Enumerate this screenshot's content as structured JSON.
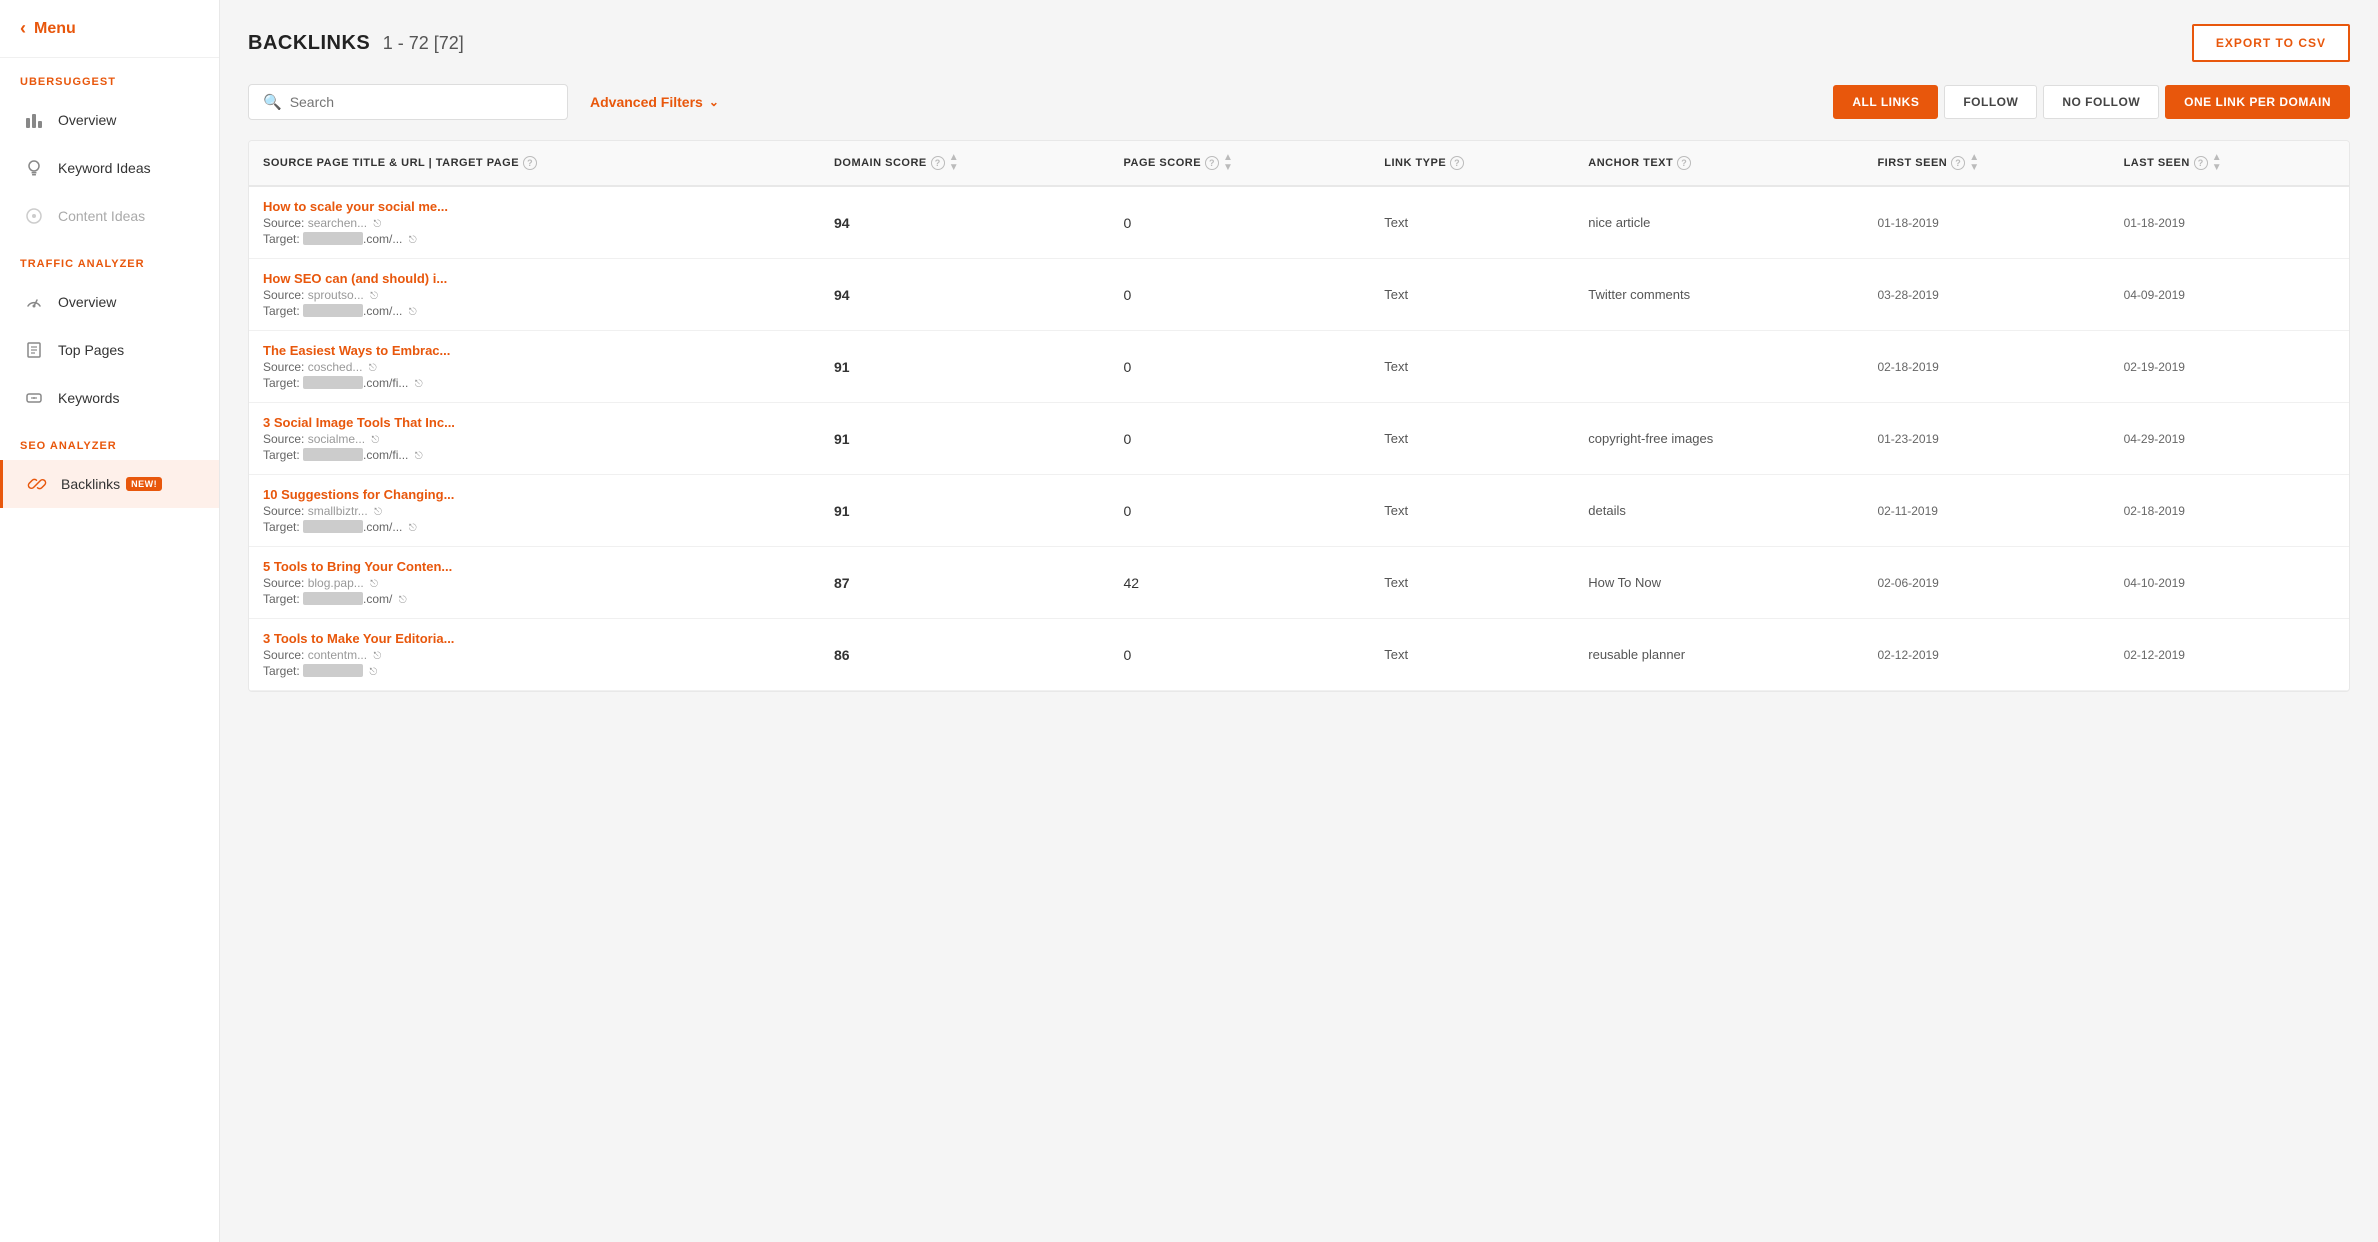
{
  "sidebar": {
    "menu_label": "Menu",
    "brand": "UBERSUGGEST",
    "sections": [
      {
        "title": null,
        "items": [
          {
            "id": "overview-seo",
            "label": "Overview",
            "icon": "bar-chart-icon"
          },
          {
            "id": "keyword-ideas",
            "label": "Keyword Ideas",
            "icon": "lightbulb-icon"
          },
          {
            "id": "content-ideas",
            "label": "Content Ideas",
            "icon": "content-icon",
            "dimmed": true
          }
        ]
      },
      {
        "title": "TRAFFIC ANALYZER",
        "items": [
          {
            "id": "overview-traffic",
            "label": "Overview",
            "icon": "gauge-icon"
          },
          {
            "id": "top-pages",
            "label": "Top Pages",
            "icon": "pages-icon"
          },
          {
            "id": "keywords",
            "label": "Keywords",
            "icon": "keywords-icon"
          }
        ]
      },
      {
        "title": "SEO ANALYZER",
        "items": [
          {
            "id": "backlinks",
            "label": "Backlinks",
            "icon": "link-icon",
            "active": true,
            "badge": "NEW!"
          }
        ]
      }
    ]
  },
  "main": {
    "title": "BACKLINKS",
    "count_range": "1 - 72 [72]",
    "export_btn": "EXPORT TO CSV",
    "search_placeholder": "Search",
    "advanced_filters_label": "Advanced Filters",
    "filter_buttons": [
      {
        "id": "all-links",
        "label": "ALL LINKS",
        "active": true
      },
      {
        "id": "follow",
        "label": "FOLLOW",
        "active": false
      },
      {
        "id": "no-follow",
        "label": "NO FOLLOW",
        "active": false
      },
      {
        "id": "one-link",
        "label": "ONE LINK PER DOMAIN",
        "active": false,
        "orange": true
      }
    ],
    "table": {
      "columns": [
        {
          "id": "source",
          "label": "SOURCE PAGE TITLE & URL | TARGET PAGE"
        },
        {
          "id": "domain_score",
          "label": "DOMAIN SCORE"
        },
        {
          "id": "page_score",
          "label": "PAGE SCORE"
        },
        {
          "id": "link_type",
          "label": "LINK TYPE"
        },
        {
          "id": "anchor_text",
          "label": "ANCHOR TEXT"
        },
        {
          "id": "first_seen",
          "label": "FIRST SEEN"
        },
        {
          "id": "last_seen",
          "label": "LAST SEEN"
        }
      ],
      "rows": [
        {
          "title": "How to scale your social me...",
          "source_domain": "searchen...",
          "target_url": ".com/...",
          "domain_score": "94",
          "page_score": "0",
          "link_type": "Text",
          "anchor_text": "nice article",
          "first_seen": "01-18-2019",
          "last_seen": "01-18-2019"
        },
        {
          "title": "How SEO can (and should) i...",
          "source_domain": "sproutso...",
          "target_url": ".com/...",
          "domain_score": "94",
          "page_score": "0",
          "link_type": "Text",
          "anchor_text": "Twitter comments",
          "first_seen": "03-28-2019",
          "last_seen": "04-09-2019"
        },
        {
          "title": "The Easiest Ways to Embrac...",
          "source_domain": "cosched...",
          "target_url": ".com/fi...",
          "domain_score": "91",
          "page_score": "0",
          "link_type": "Text",
          "anchor_text": "",
          "first_seen": "02-18-2019",
          "last_seen": "02-19-2019"
        },
        {
          "title": "3 Social Image Tools That Inc...",
          "source_domain": "socialme...",
          "target_url": ".com/fi...",
          "domain_score": "91",
          "page_score": "0",
          "link_type": "Text",
          "anchor_text": "copyright-free images",
          "first_seen": "01-23-2019",
          "last_seen": "04-29-2019"
        },
        {
          "title": "10 Suggestions for Changing...",
          "source_domain": "smallbiztr...",
          "target_url": ".com/...",
          "domain_score": "91",
          "page_score": "0",
          "link_type": "Text",
          "anchor_text": "details",
          "first_seen": "02-11-2019",
          "last_seen": "02-18-2019"
        },
        {
          "title": "5 Tools to Bring Your Conten...",
          "source_domain": "blog.pap...",
          "target_url": ".com/",
          "domain_score": "87",
          "page_score": "42",
          "link_type": "Text",
          "anchor_text": "How To Now",
          "first_seen": "02-06-2019",
          "last_seen": "04-10-2019"
        },
        {
          "title": "3 Tools to Make Your Editoria...",
          "source_domain": "contentm...",
          "target_url": "",
          "domain_score": "86",
          "page_score": "0",
          "link_type": "Text",
          "anchor_text": "reusable planner",
          "first_seen": "02-12-2019",
          "last_seen": "02-12-2019"
        }
      ]
    }
  }
}
